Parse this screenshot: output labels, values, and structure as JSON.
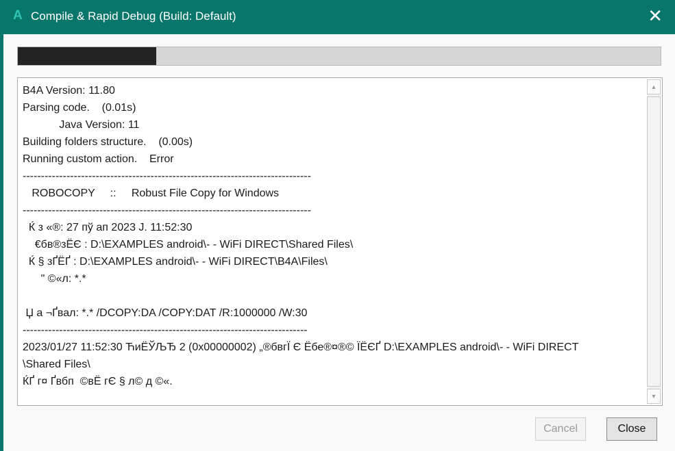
{
  "window": {
    "title": "Compile & Rapid Debug (Build: Default)",
    "app_icon": "A",
    "close_icon": "close-icon"
  },
  "progress": {
    "percent": 21.5
  },
  "log": {
    "lines": [
      "B4A Version: 11.80",
      "Parsing code.    (0.01s)",
      "            Java Version: 11",
      "Building folders structure.    (0.00s)",
      "Running custom action.    Error",
      "-------------------------------------------------------------------------------",
      "   ROBOCOPY     ::     Robust File Copy for Windows",
      "-------------------------------------------------------------------------------",
      "  Ќ з «®: 27 пў ап 2023 Ј. 11:52:30",
      "    €бв®зЁЄ : D:\\EXAMPLES android\\- - WiFi DIRECT\\Shared Files\\",
      "  Ќ § зҐЁҐ : D:\\EXAMPLES android\\- - WiFi DIRECT\\B4A\\Files\\",
      "      \" ©«л: *.*",
      "",
      " Џ а ¬Ґвал: *.* /DCOPY:DA /COPY:DAT /R:1000000 /W:30",
      "------------------------------------------------------------------------------",
      "2023/01/27 11:52:30 ЋиЁЎЉЂ 2 (0x00000002) „®бвгЇ Є Ёбе®¤®© ЇЁЄҐ D:\\EXAMPLES android\\- - WiFi DIRECT",
      "\\Shared Files\\",
      "ЌҐ г¤ Ґвбп  ©вЁ гЄ § л© д ©«."
    ]
  },
  "buttons": {
    "cancel": "Cancel",
    "close": "Close"
  }
}
